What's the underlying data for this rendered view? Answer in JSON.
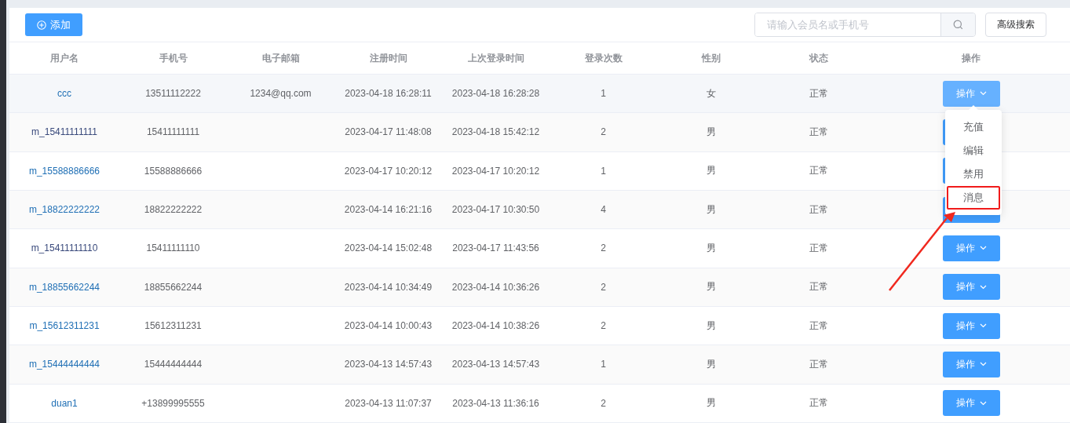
{
  "toolbar": {
    "add_button": "添加",
    "search": {
      "placeholder": "请输入会员名或手机号"
    },
    "advanced_button": "高级搜索"
  },
  "table": {
    "columns": [
      "用户名",
      "手机号",
      "电子邮箱",
      "注册时间",
      "上次登录时间",
      "登录次数",
      "性别",
      "状态",
      "操作"
    ],
    "rows": [
      {
        "username": "ccc",
        "color": "#1f6fb5",
        "phone": "13511112222",
        "email": "1234@qq.com",
        "registered": "2023-04-18 16:28:11",
        "last_login": "2023-04-18 16:28:28",
        "logins": "1",
        "gender": "女",
        "status": "正常",
        "action": "操作",
        "open": true
      },
      {
        "username": "m_15411111111",
        "color": "#3a4a7c",
        "phone": "15411111111",
        "registered": "2023-04-17 11:48:08",
        "last_login": "2023-04-18 15:42:12",
        "logins": "2",
        "gender": "男",
        "status": "正常",
        "open": false
      },
      {
        "username": "m_15588886666",
        "color": "#1f6fb5",
        "phone": "15588886666",
        "registered": "2023-04-17 10:20:12",
        "last_login": "2023-04-17 10:20:12",
        "logins": "1",
        "gender": "男",
        "status": "正常",
        "open": false
      },
      {
        "username": "m_18822222222",
        "color": "#1f6fb5",
        "phone": "18822222222",
        "registered": "2023-04-14 16:21:16",
        "last_login": "2023-04-17 10:30:50",
        "logins": "4",
        "gender": "男",
        "status": "正常",
        "open": false
      },
      {
        "username": "m_15411111110",
        "color": "#3a4a7c",
        "phone": "15411111110",
        "registered": "2023-04-14 15:02:48",
        "last_login": "2023-04-17 11:43:56",
        "logins": "2",
        "gender": "男",
        "status": "正常",
        "action": "操作",
        "open": false
      },
      {
        "username": "m_18855662244",
        "color": "#1f6fb5",
        "phone": "18855662244",
        "registered": "2023-04-14 10:34:49",
        "last_login": "2023-04-14 10:36:26",
        "logins": "2",
        "gender": "男",
        "status": "正常",
        "action": "操作",
        "open": false
      },
      {
        "username": "m_15612311231",
        "color": "#1f6fb5",
        "phone": "15612311231",
        "registered": "2023-04-14 10:00:43",
        "last_login": "2023-04-14 10:38:26",
        "logins": "2",
        "gender": "男",
        "status": "正常",
        "action": "操作",
        "open": false
      },
      {
        "username": "m_15444444444",
        "color": "#1f6fb5",
        "phone": "15444444444",
        "registered": "2023-04-13 14:57:43",
        "last_login": "2023-04-13 14:57:43",
        "logins": "1",
        "gender": "男",
        "status": "正常",
        "action": "操作",
        "open": false
      },
      {
        "username": "duan1",
        "color": "#1f6fb5",
        "phone": "+13899995555",
        "registered": "2023-04-13 11:07:37",
        "last_login": "2023-04-13 11:36:16",
        "logins": "2",
        "gender": "男",
        "status": "正常",
        "action": "操作",
        "open": false
      }
    ]
  },
  "dropdown": {
    "items": [
      {
        "label": "充值",
        "highlighted": false
      },
      {
        "label": "编辑",
        "highlighted": false
      },
      {
        "label": "禁用",
        "highlighted": false
      },
      {
        "label": "消息",
        "highlighted": true
      }
    ]
  }
}
